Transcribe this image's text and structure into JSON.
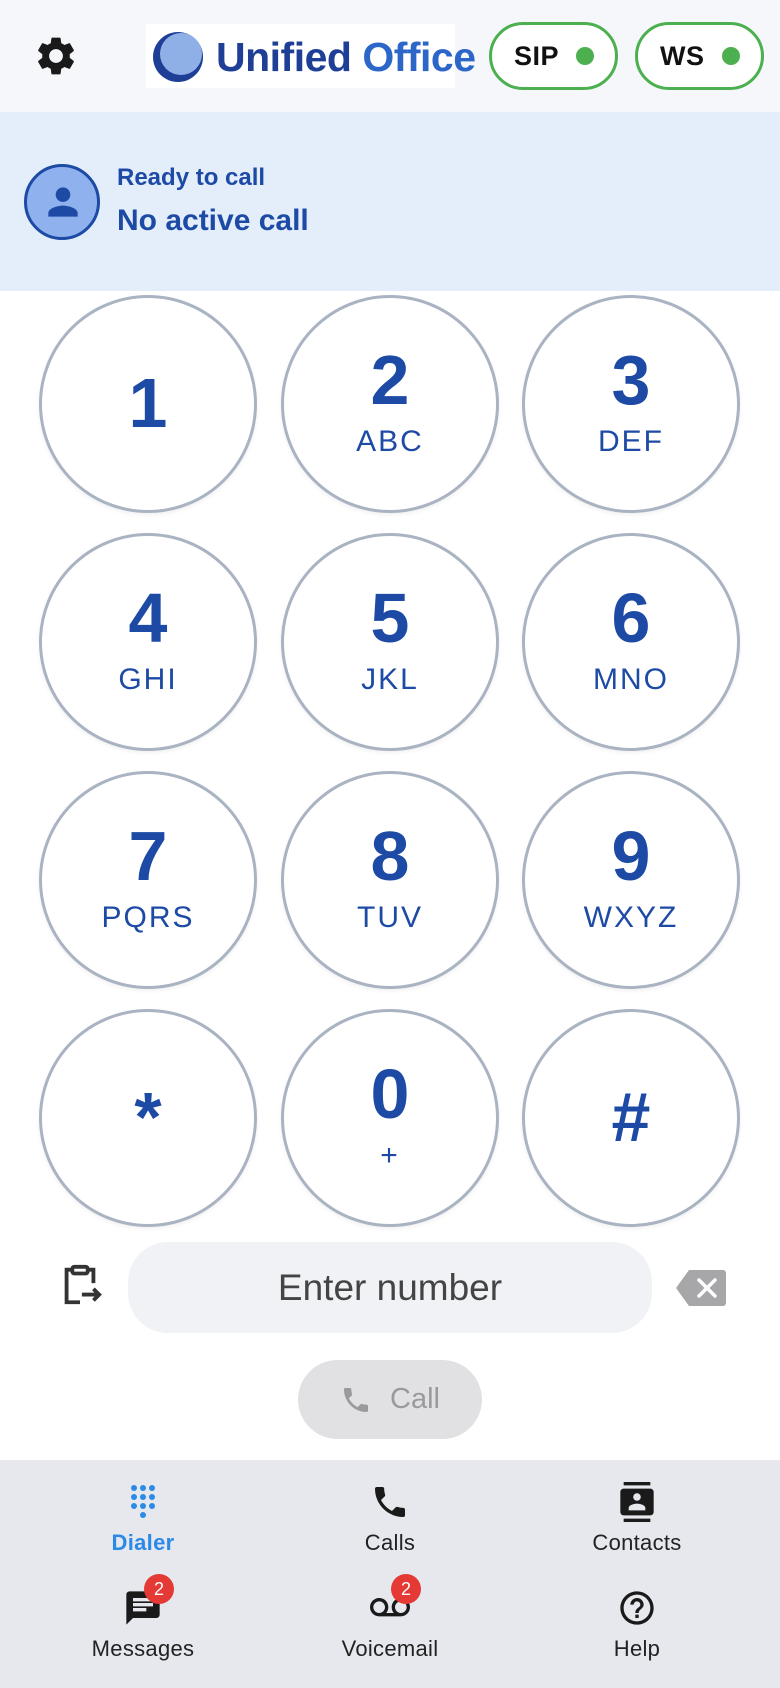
{
  "header": {
    "logo_word1": "Unified",
    "logo_word2": "Office",
    "sip_label": "SIP",
    "ws_label": "WS",
    "indicator_color": "#4caf50"
  },
  "status": {
    "line1": "Ready to call",
    "line2": "No active call"
  },
  "keypad": [
    {
      "digit": "1",
      "letters": ""
    },
    {
      "digit": "2",
      "letters": "ABC"
    },
    {
      "digit": "3",
      "letters": "DEF"
    },
    {
      "digit": "4",
      "letters": "GHI"
    },
    {
      "digit": "5",
      "letters": "JKL"
    },
    {
      "digit": "6",
      "letters": "MNO"
    },
    {
      "digit": "7",
      "letters": "PQRS"
    },
    {
      "digit": "8",
      "letters": "TUV"
    },
    {
      "digit": "9",
      "letters": "WXYZ"
    },
    {
      "digit": "*",
      "letters": ""
    },
    {
      "digit": "0",
      "letters": "+"
    },
    {
      "digit": "#",
      "letters": ""
    }
  ],
  "number_input": {
    "placeholder": "Enter number",
    "value": ""
  },
  "call_button": {
    "label": "Call",
    "enabled": false
  },
  "nav": {
    "dialer": {
      "label": "Dialer",
      "icon": "dialpad-icon",
      "active": true
    },
    "calls": {
      "label": "Calls",
      "icon": "phone-icon"
    },
    "contacts": {
      "label": "Contacts",
      "icon": "contacts-icon"
    },
    "messages": {
      "label": "Messages",
      "icon": "message-icon",
      "badge": "2"
    },
    "voicemail": {
      "label": "Voicemail",
      "icon": "voicemail-icon",
      "badge": "2"
    },
    "help": {
      "label": "Help",
      "icon": "help-icon"
    }
  },
  "colors": {
    "primary": "#1c4aa5",
    "active_nav": "#2a8ae6",
    "badge": "#e53935",
    "status_bg": "#e4edfa"
  }
}
